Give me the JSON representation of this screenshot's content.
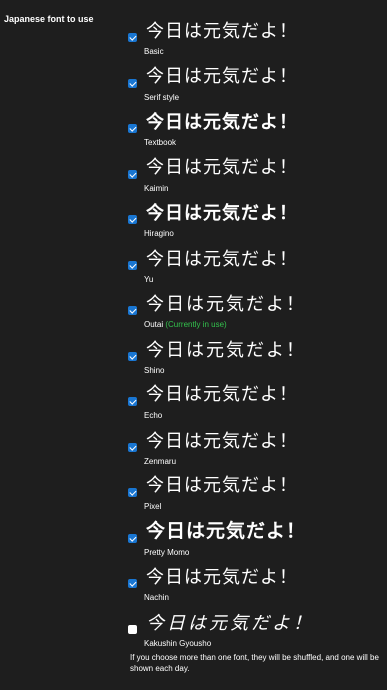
{
  "section_label": "Japanese font to use",
  "sample_text": "今日は元気だよ！",
  "fonts": [
    {
      "name": "Basic",
      "checked": true,
      "note": ""
    },
    {
      "name": "Serif style",
      "checked": true,
      "note": ""
    },
    {
      "name": "Textbook",
      "checked": true,
      "note": ""
    },
    {
      "name": "Kaimin",
      "checked": true,
      "note": ""
    },
    {
      "name": "Hiragino",
      "checked": true,
      "note": ""
    },
    {
      "name": "Yu",
      "checked": true,
      "note": ""
    },
    {
      "name": "Outai",
      "checked": true,
      "note": "(Currently in use)"
    },
    {
      "name": "Shino",
      "checked": true,
      "note": ""
    },
    {
      "name": "Echo",
      "checked": true,
      "note": ""
    },
    {
      "name": "Zenmaru",
      "checked": true,
      "note": ""
    },
    {
      "name": "Pixel",
      "checked": true,
      "note": ""
    },
    {
      "name": "Pretty Momo",
      "checked": true,
      "note": ""
    },
    {
      "name": "Nachin",
      "checked": true,
      "note": ""
    },
    {
      "name": "Kakushin Gyousho",
      "checked": false,
      "note": ""
    }
  ],
  "footnote": "If you choose more than one font, they will be shuffled, and one will be shown each day.",
  "colors": {
    "background": "#1e1e1e",
    "checkbox": "#1976d2",
    "in_use": "#33c24d"
  }
}
